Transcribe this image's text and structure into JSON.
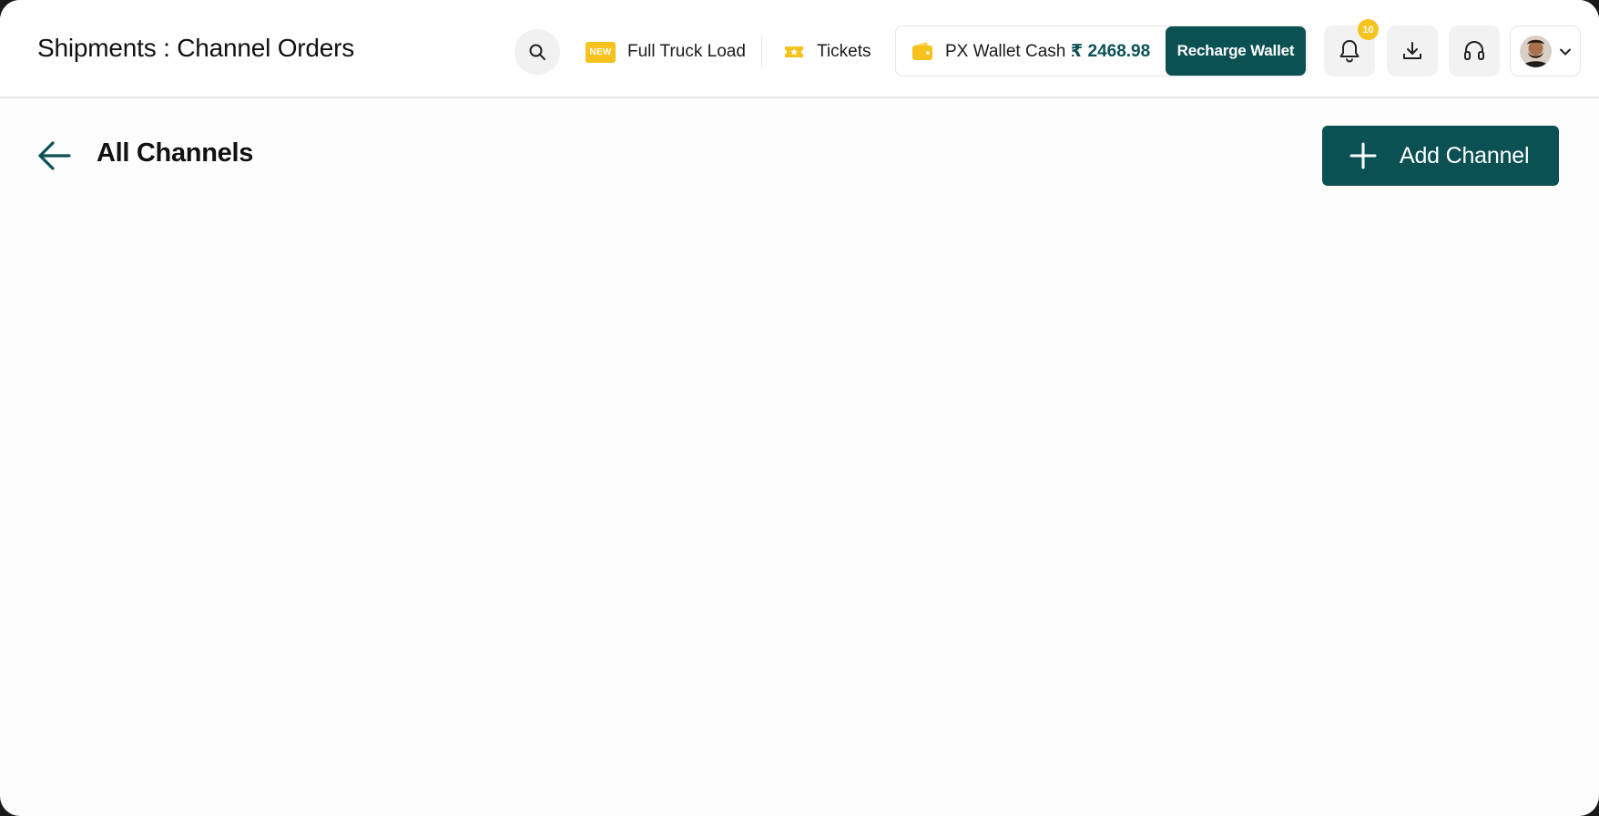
{
  "header": {
    "page_title": "Shipments : Channel Orders",
    "new_badge": "NEW",
    "full_truck_load_label": "Full Truck Load",
    "tickets_label": "Tickets",
    "wallet_label": "PX Wallet Cash :",
    "wallet_amount": "₹ 2468.98",
    "recharge_label": "Recharge Wallet",
    "notification_count": "10",
    "icons": [
      "search-icon",
      "ticket-icon",
      "wallet-icon",
      "bell-icon",
      "download-icon",
      "headset-icon",
      "chevron-down-icon"
    ]
  },
  "main": {
    "title": "All Channels",
    "add_button_label": "Add Channel",
    "icons": [
      "arrow-left-icon",
      "plus-icon"
    ]
  },
  "colors": {
    "brand": "#0b5052",
    "accent": "#f6c21d",
    "wallet_amount": "#0c5256"
  }
}
